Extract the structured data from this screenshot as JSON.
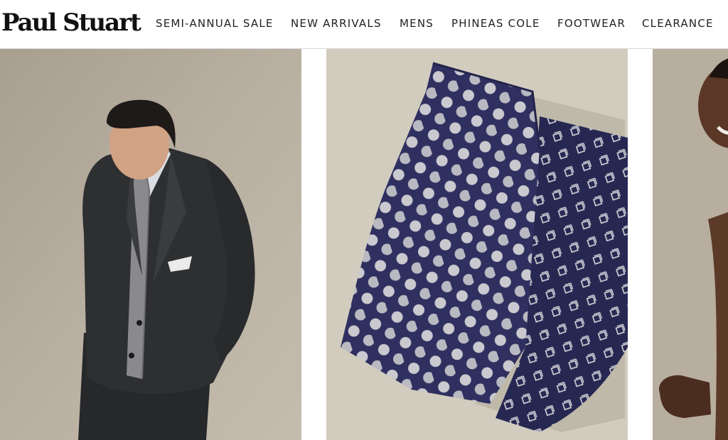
{
  "brand": {
    "name": "Paul Stuart"
  },
  "nav": {
    "items": [
      {
        "label": "SEMI-ANNUAL SALE"
      },
      {
        "label": "NEW ARRIVALS"
      },
      {
        "label": "MENS"
      },
      {
        "label": "PHINEAS COLE"
      },
      {
        "label": "FOOTWEAR"
      },
      {
        "label": "CLEARANCE"
      }
    ]
  },
  "colors": {
    "tile1_bg": "#b5ab9c",
    "tile2_bg": "#d8d2c6",
    "tie_navy": "#2e2f5c",
    "suit": "#2c2e30"
  }
}
